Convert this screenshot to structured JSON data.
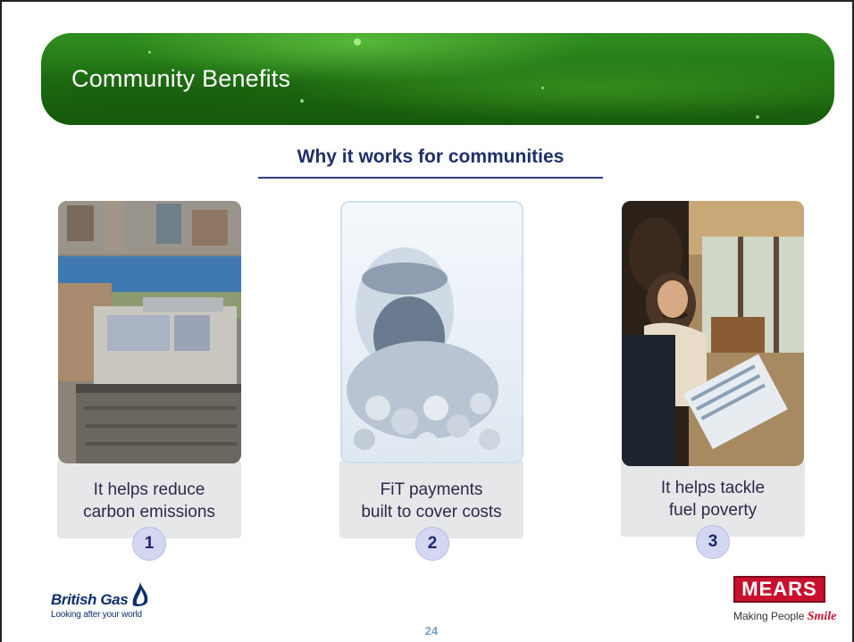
{
  "slide": {
    "title": "Community Benefits",
    "subtitle": "Why it works for communities",
    "page_number": "24"
  },
  "cards": [
    {
      "line1": "It helps reduce",
      "line2": "carbon emissions",
      "number": "1",
      "image": "city-rooftop-solar-panels"
    },
    {
      "line1": "FiT payments",
      "line2": "built to cover costs",
      "number": "2",
      "image": "jar-of-coins"
    },
    {
      "line1": "It helps tackle",
      "line2": "fuel poverty",
      "number": "3",
      "image": "people-with-clipboard"
    }
  ],
  "logos": {
    "british_gas": {
      "name": "British Gas",
      "tagline": "Looking after your world"
    },
    "mears": {
      "name": "MEARS",
      "tagline_prefix": "Making People ",
      "tagline_accent": "Smile"
    }
  },
  "colors": {
    "banner_green": "#1f6d12",
    "subtitle_navy": "#1f2f6b",
    "card_grey": "#e6e7e9",
    "badge_lavender": "#d4d7f2",
    "mears_red": "#c8102e",
    "british_gas_blue": "#0b2f6e"
  }
}
